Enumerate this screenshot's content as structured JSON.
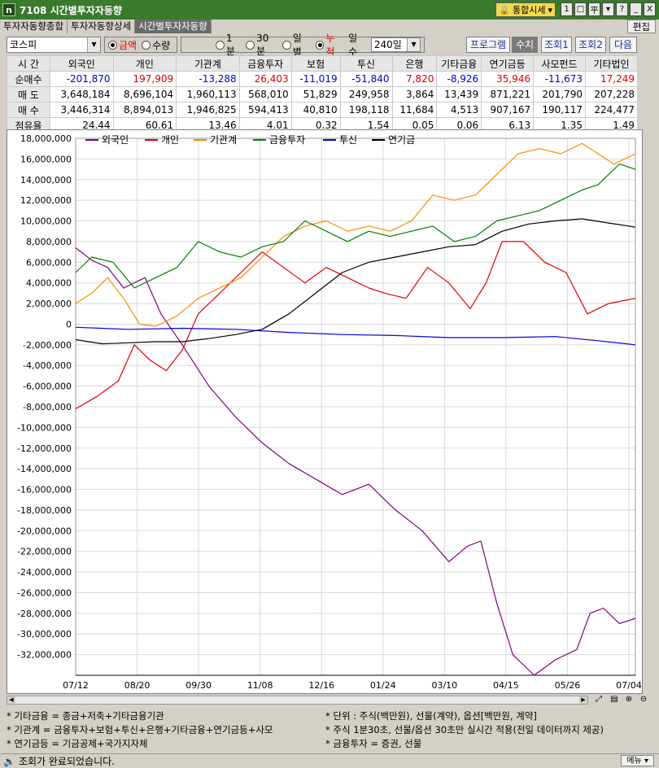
{
  "window": {
    "app_code": "7108",
    "title": "시간별투자자동향",
    "combo_label": "통합시세",
    "small_buttons": [
      "1",
      "□",
      "平",
      "▾",
      "?",
      "_",
      "X"
    ]
  },
  "tabs": [
    {
      "label": "투자자동향종합",
      "active": false
    },
    {
      "label": "투자자동향상세",
      "active": false
    },
    {
      "label": "시간별투자자동향",
      "active": true
    }
  ],
  "edit_button": "편집",
  "controls": {
    "market": "코스피",
    "amount_radios": [
      {
        "label": "금액",
        "checked": true,
        "red": true
      },
      {
        "label": "수량",
        "checked": false,
        "red": false
      }
    ],
    "period_radios": [
      {
        "label": "1분",
        "checked": false,
        "red": false
      },
      {
        "label": "30분",
        "checked": false,
        "red": false
      },
      {
        "label": "일별",
        "checked": false,
        "red": false
      },
      {
        "label": "누적",
        "checked": true,
        "red": true
      }
    ],
    "days_label": "일수",
    "days_value": "240일",
    "buttons": [
      "프로그램",
      "수치",
      "조회1",
      "조회2",
      "다음"
    ]
  },
  "table": {
    "row_header_label": "시  간",
    "columns": [
      "외국인",
      "개인",
      "기관계",
      "금융투자",
      "보험",
      "투신",
      "은행",
      "기타금융",
      "연기금등",
      "사모펀드",
      "기타법인"
    ],
    "rows": [
      {
        "label": "순매수",
        "colored": true,
        "values": [
          "-201,870",
          "197,909",
          "-13,288",
          "26,403",
          "-11,019",
          "-51,840",
          "7,820",
          "-8,926",
          "35,946",
          "-11,673",
          "17,249"
        ]
      },
      {
        "label": "매  도",
        "colored": false,
        "values": [
          "3,648,184",
          "8,696,104",
          "1,960,113",
          "568,010",
          "51,829",
          "249,958",
          "3,864",
          "13,439",
          "871,221",
          "201,790",
          "207,228"
        ]
      },
      {
        "label": "매  수",
        "colored": false,
        "values": [
          "3,446,314",
          "8,894,013",
          "1,946,825",
          "594,413",
          "40,810",
          "198,118",
          "11,684",
          "4,513",
          "907,167",
          "190,117",
          "224,477"
        ]
      },
      {
        "label": "점유율",
        "colored": false,
        "values": [
          "24.44",
          "60.61",
          "13.46",
          "4.01",
          "0.32",
          "1.54",
          "0.05",
          "0.06",
          "6.13",
          "1.35",
          "1.49"
        ]
      }
    ]
  },
  "chart_data": {
    "type": "line",
    "x_ticks": [
      "07/12",
      "08/20",
      "09/30",
      "11/08",
      "12/16",
      "01/24",
      "03/10",
      "04/15",
      "05/26",
      "07/04"
    ],
    "ylim": [
      -34000000,
      18000000
    ],
    "y_ticks": [
      18000000,
      16000000,
      14000000,
      12000000,
      10000000,
      8000000,
      6000000,
      4000000,
      2000000,
      0,
      -2000000,
      -4000000,
      -6000000,
      -8000000,
      -10000000,
      -12000000,
      -14000000,
      -16000000,
      -18000000,
      -20000000,
      -22000000,
      -24000000,
      -26000000,
      -28000000,
      -30000000,
      -32000000
    ],
    "y_tick_labels": [
      "18,000,000",
      "16,000,000",
      "14,000,000",
      "12,000,000",
      "10,000,000",
      "8,000,000",
      "6,000,000",
      "4,000,000",
      "2,000,000",
      "0",
      "-2,000,000",
      "-4,000,000",
      "-6,000,000",
      "-8,000,000",
      "-10,000,000",
      "-12,000,000",
      "-14,000,000",
      "-16,000,000",
      "-18,000,000",
      "-20,000,000",
      "-22,000,000",
      "-24,000,000",
      "-26,000,000",
      "-28,000,000",
      "-30,000,000",
      "-32,000,000"
    ],
    "grid": true,
    "legend_position": "top-left",
    "series": [
      {
        "name": "외국인",
        "color": "#800080",
        "values": [
          [
            0,
            7400000
          ],
          [
            0.03,
            6200000
          ],
          [
            0.06,
            5500000
          ],
          [
            0.09,
            3500000
          ],
          [
            0.13,
            4500000
          ],
          [
            0.16,
            1000000
          ],
          [
            0.2,
            -2000000
          ],
          [
            0.25,
            -6000000
          ],
          [
            0.3,
            -9000000
          ],
          [
            0.35,
            -11500000
          ],
          [
            0.4,
            -13500000
          ],
          [
            0.45,
            -15000000
          ],
          [
            0.5,
            -16500000
          ],
          [
            0.55,
            -15500000
          ],
          [
            0.6,
            -18000000
          ],
          [
            0.65,
            -20000000
          ],
          [
            0.7,
            -23000000
          ],
          [
            0.735,
            -21500000
          ],
          [
            0.76,
            -21000000
          ],
          [
            0.79,
            -27000000
          ],
          [
            0.82,
            -32000000
          ],
          [
            0.86,
            -34000000
          ],
          [
            0.9,
            -32500000
          ],
          [
            0.94,
            -31500000
          ],
          [
            0.965,
            -28000000
          ],
          [
            0.99,
            -27500000
          ],
          [
            1.02,
            -29000000
          ],
          [
            1.05,
            -28500000
          ]
        ]
      },
      {
        "name": "개인",
        "color": "#e00000",
        "values": [
          [
            0,
            -8200000
          ],
          [
            0.04,
            -7000000
          ],
          [
            0.08,
            -5500000
          ],
          [
            0.11,
            -2000000
          ],
          [
            0.14,
            -3500000
          ],
          [
            0.17,
            -4500000
          ],
          [
            0.2,
            -2500000
          ],
          [
            0.23,
            1000000
          ],
          [
            0.27,
            3000000
          ],
          [
            0.31,
            5000000
          ],
          [
            0.35,
            7000000
          ],
          [
            0.39,
            5500000
          ],
          [
            0.43,
            4000000
          ],
          [
            0.47,
            5500000
          ],
          [
            0.51,
            4500000
          ],
          [
            0.55,
            3500000
          ],
          [
            0.58,
            3000000
          ],
          [
            0.62,
            2500000
          ],
          [
            0.66,
            5500000
          ],
          [
            0.7,
            4000000
          ],
          [
            0.74,
            1500000
          ],
          [
            0.77,
            4000000
          ],
          [
            0.8,
            8000000
          ],
          [
            0.84,
            8000000
          ],
          [
            0.88,
            6000000
          ],
          [
            0.92,
            5000000
          ],
          [
            0.96,
            1000000
          ],
          [
            1.0,
            2000000
          ],
          [
            1.05,
            2500000
          ]
        ]
      },
      {
        "name": "기관계",
        "color": "#ff8c00",
        "values": [
          [
            0,
            2000000
          ],
          [
            0.03,
            3000000
          ],
          [
            0.06,
            4500000
          ],
          [
            0.09,
            2500000
          ],
          [
            0.12,
            0
          ],
          [
            0.15,
            -200000
          ],
          [
            0.19,
            800000
          ],
          [
            0.23,
            2500000
          ],
          [
            0.27,
            3500000
          ],
          [
            0.31,
            4500000
          ],
          [
            0.35,
            6500000
          ],
          [
            0.39,
            8500000
          ],
          [
            0.43,
            9500000
          ],
          [
            0.47,
            10000000
          ],
          [
            0.51,
            9000000
          ],
          [
            0.55,
            9500000
          ],
          [
            0.59,
            9000000
          ],
          [
            0.63,
            10000000
          ],
          [
            0.67,
            12500000
          ],
          [
            0.71,
            12000000
          ],
          [
            0.75,
            12500000
          ],
          [
            0.79,
            14500000
          ],
          [
            0.83,
            16500000
          ],
          [
            0.87,
            17000000
          ],
          [
            0.91,
            16500000
          ],
          [
            0.95,
            17500000
          ],
          [
            0.98,
            16500000
          ],
          [
            1.01,
            15500000
          ],
          [
            1.05,
            16500000
          ]
        ]
      },
      {
        "name": "금융투자",
        "color": "#008000",
        "values": [
          [
            0,
            5000000
          ],
          [
            0.03,
            6500000
          ],
          [
            0.07,
            6000000
          ],
          [
            0.11,
            3500000
          ],
          [
            0.15,
            4500000
          ],
          [
            0.19,
            5500000
          ],
          [
            0.23,
            8000000
          ],
          [
            0.27,
            7000000
          ],
          [
            0.31,
            6500000
          ],
          [
            0.35,
            7500000
          ],
          [
            0.39,
            8000000
          ],
          [
            0.43,
            10000000
          ],
          [
            0.47,
            9000000
          ],
          [
            0.51,
            8000000
          ],
          [
            0.55,
            9000000
          ],
          [
            0.59,
            8500000
          ],
          [
            0.63,
            9000000
          ],
          [
            0.67,
            9500000
          ],
          [
            0.71,
            8000000
          ],
          [
            0.75,
            8500000
          ],
          [
            0.79,
            10000000
          ],
          [
            0.83,
            10500000
          ],
          [
            0.87,
            11000000
          ],
          [
            0.91,
            12000000
          ],
          [
            0.95,
            13000000
          ],
          [
            0.98,
            13500000
          ],
          [
            1.02,
            15500000
          ],
          [
            1.05,
            15000000
          ]
        ]
      },
      {
        "name": "투신",
        "color": "#0000e0",
        "values": [
          [
            0,
            -300000
          ],
          [
            0.1,
            -500000
          ],
          [
            0.2,
            -400000
          ],
          [
            0.3,
            -500000
          ],
          [
            0.4,
            -800000
          ],
          [
            0.5,
            -1000000
          ],
          [
            0.6,
            -1100000
          ],
          [
            0.7,
            -1300000
          ],
          [
            0.8,
            -1300000
          ],
          [
            0.9,
            -1200000
          ],
          [
            0.98,
            -1600000
          ],
          [
            1.05,
            -2000000
          ]
        ]
      },
      {
        "name": "연기금",
        "color": "#000000",
        "values": [
          [
            0,
            -1500000
          ],
          [
            0.05,
            -1900000
          ],
          [
            0.1,
            -1800000
          ],
          [
            0.15,
            -1700000
          ],
          [
            0.2,
            -1700000
          ],
          [
            0.25,
            -1400000
          ],
          [
            0.3,
            -1000000
          ],
          [
            0.35,
            -500000
          ],
          [
            0.4,
            1000000
          ],
          [
            0.45,
            3000000
          ],
          [
            0.5,
            5000000
          ],
          [
            0.55,
            6000000
          ],
          [
            0.6,
            6500000
          ],
          [
            0.65,
            7000000
          ],
          [
            0.7,
            7500000
          ],
          [
            0.75,
            7700000
          ],
          [
            0.8,
            9000000
          ],
          [
            0.85,
            9700000
          ],
          [
            0.9,
            10000000
          ],
          [
            0.95,
            10200000
          ],
          [
            1.0,
            9800000
          ],
          [
            1.05,
            9400000
          ]
        ]
      }
    ]
  },
  "notes": [
    "* 기타금융 = 종금+저축+기타금융기관",
    "* 단위 : 주식(백만원), 선물(계약), 옵션[백만원, 계약]",
    "* 기관계 = 금융투자+보험+투신+은행+기타금융+연기금등+사모",
    "* 주식 1분30초, 선물/옵션 30초만 실시간 적용(전일 데이터까지 제공)",
    "* 연기금등 = 기금공제+국가지자체",
    "* 금융투자 = 증권, 선물"
  ],
  "status": {
    "message": "조회가 완료되었습니다.",
    "menu_label": "메뉴"
  }
}
